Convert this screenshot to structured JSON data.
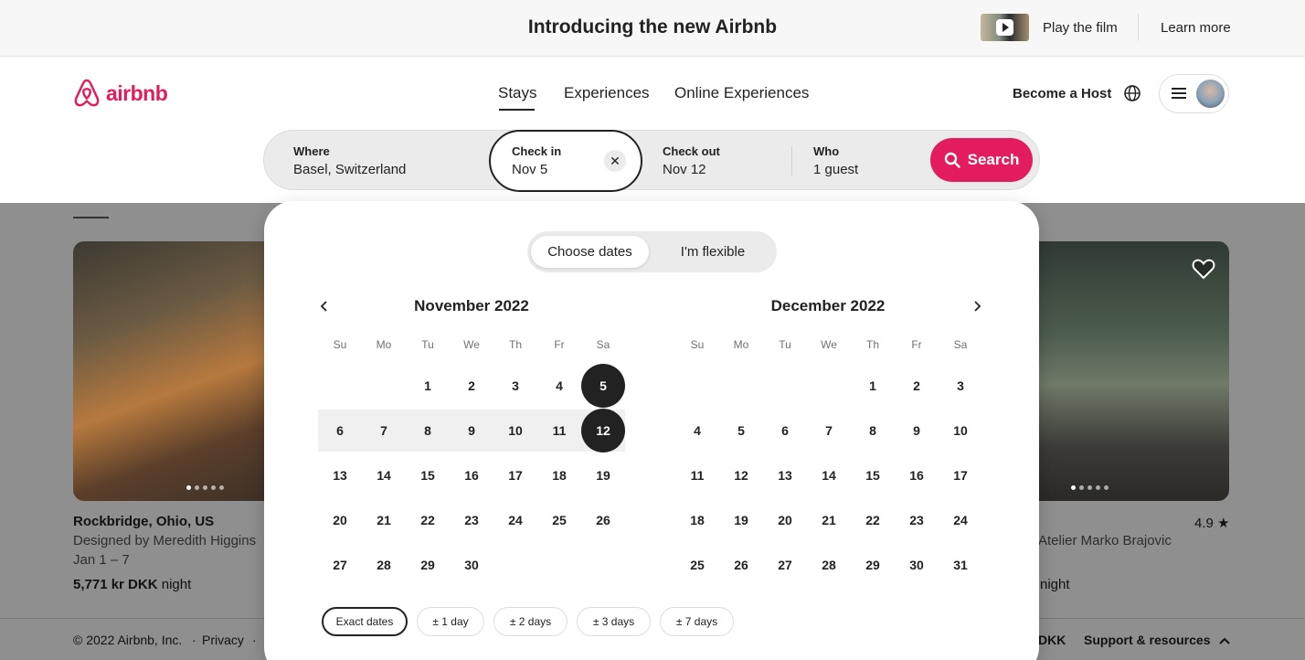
{
  "banner": {
    "title": "Introducing the new Airbnb",
    "play_label": "Play the film",
    "learn_label": "Learn more"
  },
  "header": {
    "logo_text": "airbnb",
    "nav": [
      "Stays",
      "Experiences",
      "Online Experiences"
    ],
    "host_label": "Become a Host"
  },
  "search": {
    "where_label": "Where",
    "where_value": "Basel, Switzerland",
    "checkin_label": "Check in",
    "checkin_value": "Nov 5",
    "checkout_label": "Check out",
    "checkout_value": "Nov 12",
    "who_label": "Who",
    "who_value": "1 guest",
    "button_label": "Search"
  },
  "calendar": {
    "mode_choose": "Choose dates",
    "mode_flexible": "I'm flexible",
    "weekdays": [
      "Su",
      "Mo",
      "Tu",
      "We",
      "Th",
      "Fr",
      "Sa"
    ],
    "months": [
      {
        "title": "November 2022",
        "weeks": [
          [
            "",
            "",
            "1",
            "2",
            "3",
            "4",
            "5"
          ],
          [
            "6",
            "7",
            "8",
            "9",
            "10",
            "11",
            "12"
          ],
          [
            "13",
            "14",
            "15",
            "16",
            "17",
            "18",
            "19"
          ],
          [
            "20",
            "21",
            "22",
            "23",
            "24",
            "25",
            "26"
          ],
          [
            "27",
            "28",
            "29",
            "30",
            "",
            "",
            ""
          ]
        ]
      },
      {
        "title": "December 2022",
        "weeks": [
          [
            "",
            "",
            "",
            "",
            "1",
            "2",
            "3"
          ],
          [
            "4",
            "5",
            "6",
            "7",
            "8",
            "9",
            "10"
          ],
          [
            "11",
            "12",
            "13",
            "14",
            "15",
            "16",
            "17"
          ],
          [
            "18",
            "19",
            "20",
            "21",
            "22",
            "23",
            "24"
          ],
          [
            "25",
            "26",
            "27",
            "28",
            "29",
            "30",
            "31"
          ]
        ]
      }
    ],
    "selected_start": "5",
    "selected_end": "12",
    "chips": [
      "Exact dates",
      "± 1 day",
      "± 2 days",
      "± 3 days",
      "± 7 days"
    ]
  },
  "listings": {
    "left": {
      "title": "Rockbridge, Ohio, US",
      "designer": "Designed by Meredith Higgins",
      "dates": "Jan 1 – 7",
      "price": "5,771 kr DKK",
      "price_suffix": "night"
    },
    "right": {
      "designer": "Atelier Marko Brajovic",
      "price_suffix": "night",
      "rating": "4.9 ★"
    }
  },
  "footer": {
    "copyright": "© 2022 Airbnb, Inc.",
    "privacy": "Privacy",
    "currency": "DKK",
    "support": "Support & resources"
  },
  "colors": {
    "brand": "#e31c5f",
    "selected_day": "#222222",
    "overlay": "#8f8f8f"
  }
}
